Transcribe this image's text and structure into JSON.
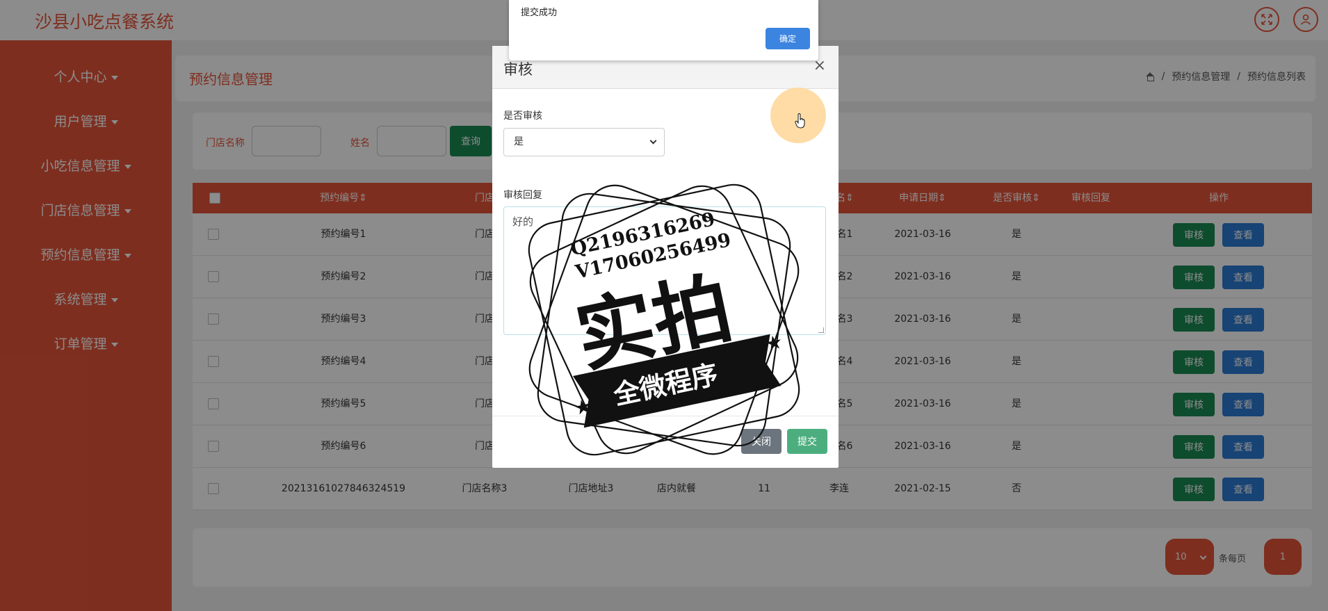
{
  "header": {
    "app_title": "沙县小吃点餐系统"
  },
  "sidebar": {
    "items": [
      {
        "label": "个人中心"
      },
      {
        "label": "用户管理"
      },
      {
        "label": "小吃信息管理"
      },
      {
        "label": "门店信息管理"
      },
      {
        "label": "预约信息管理"
      },
      {
        "label": "系统管理"
      },
      {
        "label": "订单管理"
      }
    ]
  },
  "page": {
    "title": "预约信息管理",
    "breadcrumb": [
      "预约信息管理",
      "/",
      "预约信息列表"
    ]
  },
  "search": {
    "store_label": "门店名称",
    "name_label": "姓名",
    "query_button": "查询"
  },
  "table": {
    "headers": {
      "booking_no": "预约编号",
      "store": "门店",
      "name": "名",
      "apply_date": "申请日期",
      "audited": "是否审核",
      "reply": "审核回复",
      "actions": "操作"
    },
    "rows": [
      {
        "booking_no": "预约编号1",
        "store": "门店",
        "name": "名1",
        "apply_date": "2021-03-16",
        "audited": "是"
      },
      {
        "booking_no": "预约编号2",
        "store": "门店",
        "name": "名2",
        "apply_date": "2021-03-16",
        "audited": "是"
      },
      {
        "booking_no": "预约编号3",
        "store": "门店",
        "name": "名3",
        "apply_date": "2021-03-16",
        "audited": "是"
      },
      {
        "booking_no": "预约编号4",
        "store": "门店",
        "name": "名4",
        "apply_date": "2021-03-16",
        "audited": "是"
      },
      {
        "booking_no": "预约编号5",
        "store": "门店",
        "name": "名5",
        "apply_date": "2021-03-16",
        "audited": "是"
      },
      {
        "booking_no": "预约编号6",
        "store": "门店",
        "name": "名6",
        "apply_date": "2021-03-16",
        "audited": "是"
      },
      {
        "booking_no": "20213161027846324519",
        "store": "门店名称3",
        "address": "门店地址3",
        "type": "店内就餐",
        "count": "11",
        "name": "李连",
        "apply_date": "2021-02-15",
        "audited": "否"
      }
    ],
    "audit_button": "审核",
    "view_button": "查看"
  },
  "pagination": {
    "page_size": "10",
    "per_page_label": "条每页",
    "current_page": "1"
  },
  "modal": {
    "title": "审核",
    "close_symbol": "×",
    "audit_label": "是否审核",
    "audit_value": "是",
    "reply_label": "审核回复",
    "reply_value": "好的",
    "close_button": "关闭",
    "submit_button": "提交"
  },
  "alert": {
    "message": "提交成功",
    "ok_button": "确定"
  },
  "watermark": {
    "line1": "Q2196316269",
    "line2": "V17060256499",
    "big": "实拍",
    "banner": "全微程序"
  },
  "colors": {
    "accent": "#e5553a",
    "green": "#1a8a55",
    "blue": "#2b7bd6"
  }
}
